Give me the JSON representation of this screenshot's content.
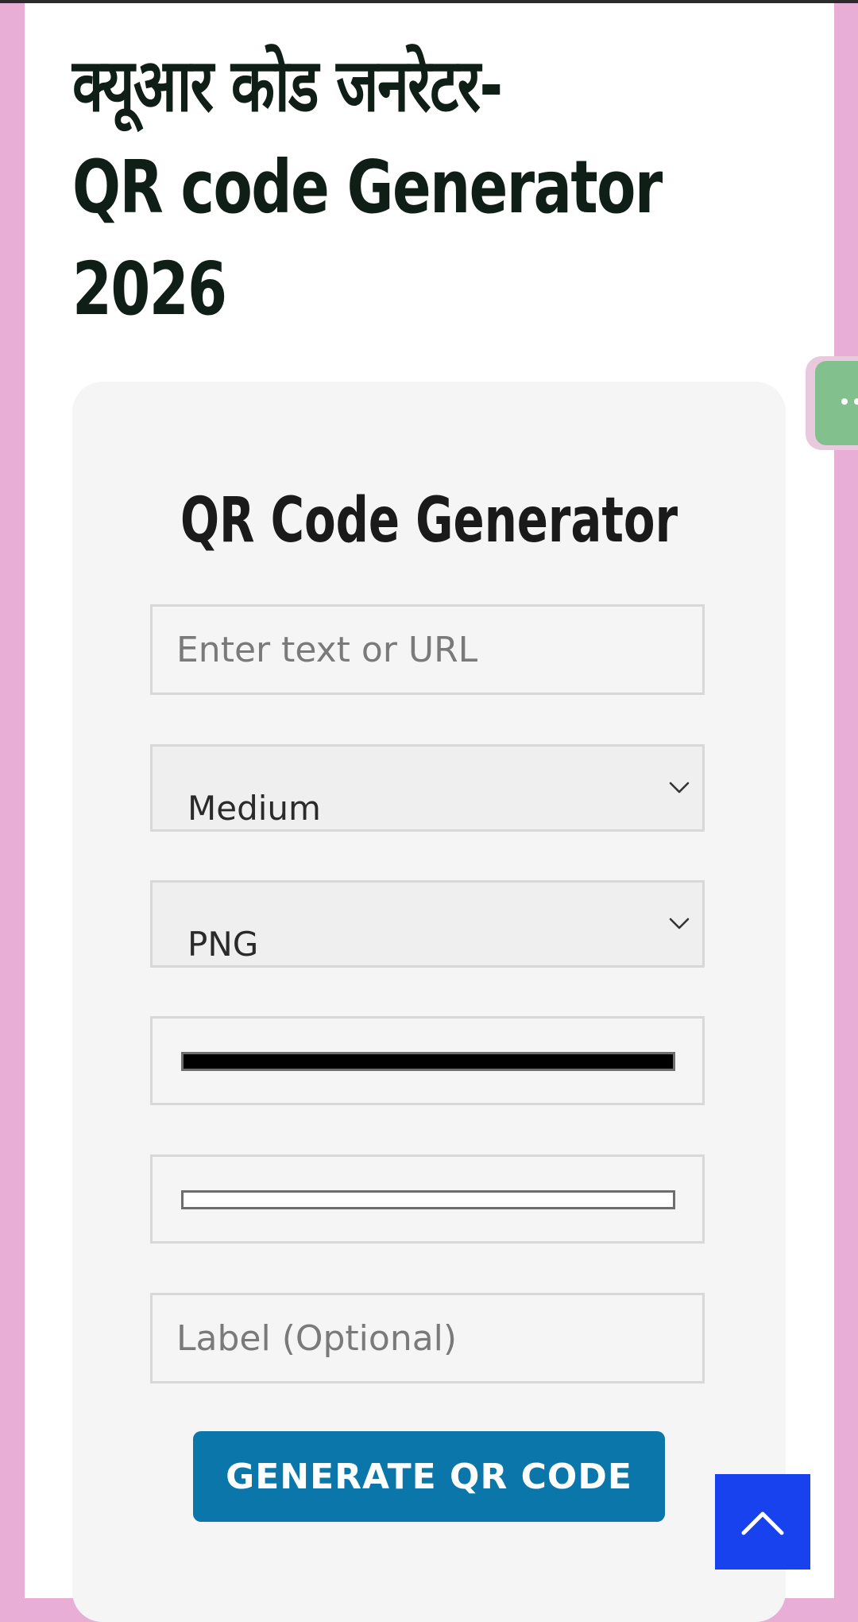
{
  "page": {
    "title_lines": [
      "क्यूआर कोड जनरेटर-",
      "QR code Generator",
      "2026"
    ]
  },
  "generator": {
    "title": "QR Code Generator",
    "text_placeholder": "Enter text or URL",
    "error_correction": {
      "selected": "Medium"
    },
    "format": {
      "selected": "PNG"
    },
    "foreground_color": "#000000",
    "background_color": "#ffffff",
    "label_placeholder": "Label (Optional)",
    "generate_label": "GENERATE QR CODE"
  },
  "icons": {
    "select_arrow": "chevron-down-icon",
    "scroll_top": "chevron-up-icon",
    "side_tab": "more-dots-icon"
  },
  "colors": {
    "page_background": "#e8aed6",
    "accent_button": "#0a76a9",
    "scroll_top": "#1842ee",
    "side_tab": "#82c08e"
  }
}
